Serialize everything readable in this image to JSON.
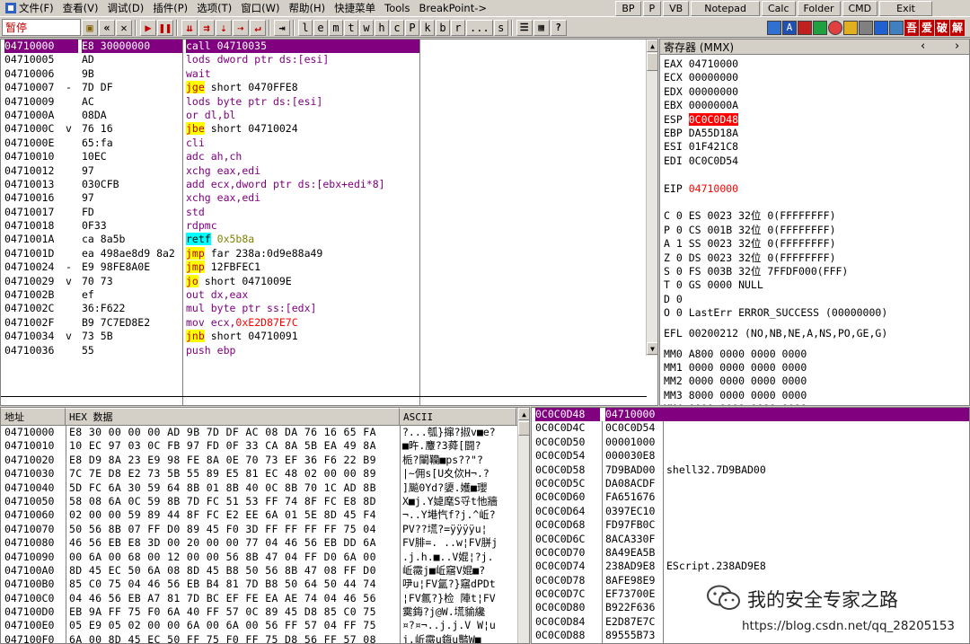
{
  "menu": {
    "items": [
      "文件(F)",
      "查看(V)",
      "调试(D)",
      "插件(P)",
      "选项(T)",
      "窗口(W)",
      "帮助(H)",
      "快捷菜单",
      "Tools",
      "BreakPoint->"
    ],
    "buttons": [
      "BP",
      "P",
      "VB",
      "Notepad",
      "Calc",
      "Folder",
      "CMD",
      "Exit"
    ]
  },
  "toolbar": {
    "status": "暂停",
    "letters": [
      "l",
      "e",
      "m",
      "t",
      "w",
      "h",
      "c",
      "P",
      "k",
      "b",
      "r",
      "...",
      "s"
    ],
    "chinese_buttons": [
      "吾",
      "爱",
      "破",
      "解"
    ]
  },
  "disasm": {
    "rows": [
      {
        "addr": "04710000",
        "mark": "",
        "hex": "E8 30000000",
        "mn": "call",
        "ops": "04710035",
        "mnStyle": "call",
        "opStyle": "plain",
        "selected": true
      },
      {
        "addr": "04710005",
        "mark": "",
        "hex": "AD",
        "mn": "lods",
        "ops": "dword ptr ds:[esi]",
        "mnStyle": "purple",
        "opStyle": "purple"
      },
      {
        "addr": "04710006",
        "mark": "",
        "hex": "9B",
        "mn": "wait",
        "ops": "",
        "mnStyle": "purple",
        "opStyle": "plain"
      },
      {
        "addr": "04710007",
        "mark": "-",
        "hex": "7D DF",
        "mn": "jge",
        "ops": "short 0470FFE8",
        "mnStyle": "jmp",
        "opStyle": "plain"
      },
      {
        "addr": "04710009",
        "mark": "",
        "hex": "AC",
        "mn": "lods",
        "ops": "byte ptr ds:[esi]",
        "mnStyle": "purple",
        "opStyle": "purple"
      },
      {
        "addr": "0471000A",
        "mark": "",
        "hex": "08DA",
        "mn": "or",
        "ops": "dl,bl",
        "mnStyle": "purple",
        "opStyle": "purple"
      },
      {
        "addr": "0471000C",
        "mark": "v",
        "hex": "76 16",
        "mn": "jbe",
        "ops": "short 04710024",
        "mnStyle": "jmp",
        "opStyle": "plain"
      },
      {
        "addr": "0471000E",
        "mark": "",
        "hex": "65:fa",
        "mn": "cli",
        "ops": "",
        "mnStyle": "purple",
        "opStyle": "plain"
      },
      {
        "addr": "04710010",
        "mark": "",
        "hex": "10EC",
        "mn": "adc",
        "ops": "ah,ch",
        "mnStyle": "purple",
        "opStyle": "purple"
      },
      {
        "addr": "04710012",
        "mark": "",
        "hex": "97",
        "mn": "xchg",
        "ops": "eax,edi",
        "mnStyle": "purple",
        "opStyle": "purple"
      },
      {
        "addr": "04710013",
        "mark": "",
        "hex": "030CFB",
        "mn": "add",
        "ops": "ecx,dword ptr ds:[ebx+edi*8]",
        "mnStyle": "purple",
        "opStyle": "purple"
      },
      {
        "addr": "04710016",
        "mark": "",
        "hex": "97",
        "mn": "xchg",
        "ops": "eax,edi",
        "mnStyle": "purple",
        "opStyle": "purple"
      },
      {
        "addr": "04710017",
        "mark": "",
        "hex": "FD",
        "mn": "std",
        "ops": "",
        "mnStyle": "purple",
        "opStyle": "plain"
      },
      {
        "addr": "04710018",
        "mark": "",
        "hex": "0F33",
        "mn": "rdpmc",
        "ops": "",
        "mnStyle": "purple",
        "opStyle": "plain"
      },
      {
        "addr": "0471001A",
        "mark": "",
        "hex": "ca 8a5b",
        "mn": "retf",
        "ops": "0x5b8a",
        "mnStyle": "retf",
        "opStyle": "olive"
      },
      {
        "addr": "0471001D",
        "mark": "",
        "hex": "ea 498ae8d9 8a2",
        "mn": "jmp",
        "ops": "far 238a:0d9e88a49",
        "mnStyle": "jmp",
        "opStyle": "plain"
      },
      {
        "addr": "04710024",
        "mark": "-",
        "hex": "E9 98FE8A0E",
        "mn": "jmp",
        "ops": "12FBFEC1",
        "mnStyle": "jmp",
        "opStyle": "plain"
      },
      {
        "addr": "04710029",
        "mark": "v",
        "hex": "70 73",
        "mn": "jo",
        "ops": "short 0471009E",
        "mnStyle": "jmp",
        "opStyle": "plain"
      },
      {
        "addr": "0471002B",
        "mark": "",
        "hex": "ef",
        "mn": "out",
        "ops": "dx,eax",
        "mnStyle": "purple",
        "opStyle": "purple"
      },
      {
        "addr": "0471002C",
        "mark": "",
        "hex": "36:F622",
        "mn": "mul",
        "ops": "byte ptr ss:[edx]",
        "mnStyle": "purple",
        "opStyle": "purple"
      },
      {
        "addr": "0471002F",
        "mark": "",
        "hex": "B9 7C7ED8E2",
        "mn": "mov",
        "ops": "ecx,0xE2D87E7C",
        "mnStyle": "purple",
        "opStyle": "mixred"
      },
      {
        "addr": "04710034",
        "mark": "v",
        "hex": "73 5B",
        "mn": "jnb",
        "ops": "short 04710091",
        "mnStyle": "jmp",
        "opStyle": "plain"
      },
      {
        "addr": "04710036",
        "mark": "",
        "hex": "55",
        "mn": "push",
        "ops": "ebp",
        "mnStyle": "purple",
        "opStyle": "purple"
      }
    ]
  },
  "registers": {
    "title": "寄存器 (MMX)",
    "gp": [
      {
        "name": "EAX",
        "value": "04710000",
        "style": "plain"
      },
      {
        "name": "ECX",
        "value": "00000000",
        "style": "plain"
      },
      {
        "name": "EDX",
        "value": "00000000",
        "style": "plain"
      },
      {
        "name": "EBX",
        "value": "0000000A",
        "style": "plain"
      },
      {
        "name": "ESP",
        "value": "0C0C0D48",
        "style": "hl"
      },
      {
        "name": "EBP",
        "value": "DA55D18A",
        "style": "plain"
      },
      {
        "name": "ESI",
        "value": "01F421C8",
        "style": "plain"
      },
      {
        "name": "EDI",
        "value": "0C0C0D54",
        "style": "plain"
      }
    ],
    "eip": {
      "name": "EIP",
      "value": "04710000"
    },
    "flags": [
      "C 0  ES 0023 32位 0(FFFFFFFF)",
      "P 0  CS 001B 32位 0(FFFFFFFF)",
      "A 1  SS 0023 32位 0(FFFFFFFF)",
      "Z 0  DS 0023 32位 0(FFFFFFFF)",
      "S 0  FS 003B 32位 7FFDF000(FFF)",
      "T 0  GS 0000 NULL",
      "D 0",
      "O 0  LastErr ERROR_SUCCESS (00000000)"
    ],
    "efl": "EFL 00200212 (NO,NB,NE,A,NS,PO,GE,G)",
    "mmx": [
      "MM0 A800 0000 0000 0000",
      "MM1 0000 0000 0000 0000",
      "MM2 0000 0000 0000 0000",
      "MM3 8000 0000 0000 0000",
      "MM4 0000 0000 0000 0000"
    ]
  },
  "dump": {
    "headers": [
      "地址",
      "HEX 数据",
      "ASCII"
    ],
    "rows": [
      {
        "addr": "04710000",
        "hex": "E8 30 00 00 00 AD 9B 7D DF AC 08 DA 76 16 65 FA",
        "ascii": "?...瓠}撺?掓v■e?"
      },
      {
        "addr": "04710010",
        "hex": "10 EC 97 03 0C FB 97 FD 0F 33 CA 8A 5B EA 49 8A",
        "ascii": "■旿.麞?3蕣[闘?"
      },
      {
        "addr": "04710020",
        "hex": "E8 D9 8A 23 E9 98 FE 8A 0E 70 73 EF 36 F6 22 B9",
        "ascii": "栀?閳韊■ps??\"?"
      },
      {
        "addr": "04710030",
        "hex": "7C 7E D8 E2 73 5B 55 89 E5 81 EC 48 02 00 00 89",
        "ascii": "|~佣s[U夊佽H¬.?"
      },
      {
        "addr": "04710040",
        "hex": "5D FC 6A 30 59 64 8B 01 8B 40 0C 8B 70 1C AD 8B",
        "ascii": "]飈0Yd?嬃.嬳■瓔"
      },
      {
        "addr": "04710050",
        "hex": "58 08 6A 0C 59 8B 7D FC 51 53 FF 74 8F FC E8 8D",
        "ascii": "X■j.Y媫麾S寽t忚牆"
      },
      {
        "addr": "04710060",
        "hex": "02 00 00 59 89 44 8F FC E2 EE 6A 01 5E 8D 45 F4",
        "ascii": "¬..Y塂忾f?j.^岴?"
      },
      {
        "addr": "04710070",
        "hex": "50 56 8B 07 FF D0 89 45 F0 3D FF FF FF FF 75 04",
        "ascii": "PV??塃?=ÿÿÿÿu¦"
      },
      {
        "addr": "04710080",
        "hex": "46 56 EB E8 3D 00 20 00 00 77 04 46 56 EB DD 6A",
        "ascii": "FV腓=. ..w¦FV胼j"
      },
      {
        "addr": "04710090",
        "hex": "00 6A 00 68 00 12 00 00 56 8B 47 04 FF D0 6A 00",
        "ascii": ".j.h.■..V婫¦?j."
      },
      {
        "addr": "047100A0",
        "hex": "8D 45 EC 50 6A 08 8D 45 B8 50 56 8B 47 08 FF D0",
        "ascii": "岴霺j■岴窹V婫■?"
      },
      {
        "addr": "047100B0",
        "hex": "85 C0 75 04 46 56 EB B4 81 7D B8 50 64 50 44 74",
        "ascii": "吚u¦FV氲?}窹dPDt"
      },
      {
        "addr": "047100C0",
        "hex": "04 46 56 EB A7 81 7D BC EF FE EA AE 74 04 46 56",
        "ascii": "¦FV氱?}检 陣t¦FV"
      },
      {
        "addr": "047100D0",
        "hex": "EB 9A FF 75 F0 6A 40 FF 57 0C 89 45 D8 85 C0 75",
        "ascii": "霙鋂?j@W.塃貐纔"
      },
      {
        "addr": "047100E0",
        "hex": "05 E9 05 02 00 00 6A 00 6A 00 56 FF 57 04 FF 75",
        "ascii": "¤?¤¬..j.j.V W¦u"
      },
      {
        "addr": "047100F0",
        "hex": "6A 00 8D 45 EC 50 FF 75 F0 FF 75 D8 56 FF 57 08",
        "ascii": "j.岴霺u鋂u豓W■"
      }
    ]
  },
  "stack": {
    "rows": [
      {
        "addr": "0C0C0D48",
        "val": "04710000",
        "cmt": "",
        "selected": true
      },
      {
        "addr": "0C0C0D4C",
        "val": "0C0C0D54",
        "cmt": ""
      },
      {
        "addr": "0C0C0D50",
        "val": "00001000",
        "cmt": ""
      },
      {
        "addr": "0C0C0D54",
        "val": "000030E8",
        "cmt": ""
      },
      {
        "addr": "0C0C0D58",
        "val": "7D9BAD00",
        "cmt": "shell32.7D9BAD00"
      },
      {
        "addr": "0C0C0D5C",
        "val": "DA08ACDF",
        "cmt": ""
      },
      {
        "addr": "0C0C0D60",
        "val": "FA651676",
        "cmt": ""
      },
      {
        "addr": "0C0C0D64",
        "val": "0397EC10",
        "cmt": ""
      },
      {
        "addr": "0C0C0D68",
        "val": "FD97FB0C",
        "cmt": ""
      },
      {
        "addr": "0C0C0D6C",
        "val": "8ACA330F",
        "cmt": ""
      },
      {
        "addr": "0C0C0D70",
        "val": "8A49EA5B",
        "cmt": ""
      },
      {
        "addr": "0C0C0D74",
        "val": "238AD9E8",
        "cmt": "EScript.238AD9E8"
      },
      {
        "addr": "0C0C0D78",
        "val": "8AFE98E9",
        "cmt": ""
      },
      {
        "addr": "0C0C0D7C",
        "val": "EF73700E",
        "cmt": ""
      },
      {
        "addr": "0C0C0D80",
        "val": "B922F636",
        "cmt": ""
      },
      {
        "addr": "0C0C0D84",
        "val": "E2D87E7C",
        "cmt": ""
      },
      {
        "addr": "0C0C0D88",
        "val": "89555B73",
        "cmt": ""
      }
    ]
  },
  "watermark": {
    "name": "我的安全专家之路",
    "url": "https://blog.csdn.net/qq_28205153"
  },
  "colors": {
    "selection": "#800080",
    "call_bg": "#ff0000",
    "jump_bg": "#ffff00",
    "ret_bg": "#00ffff",
    "mnemonic": "#800080",
    "changed_register": "#ff0000"
  }
}
